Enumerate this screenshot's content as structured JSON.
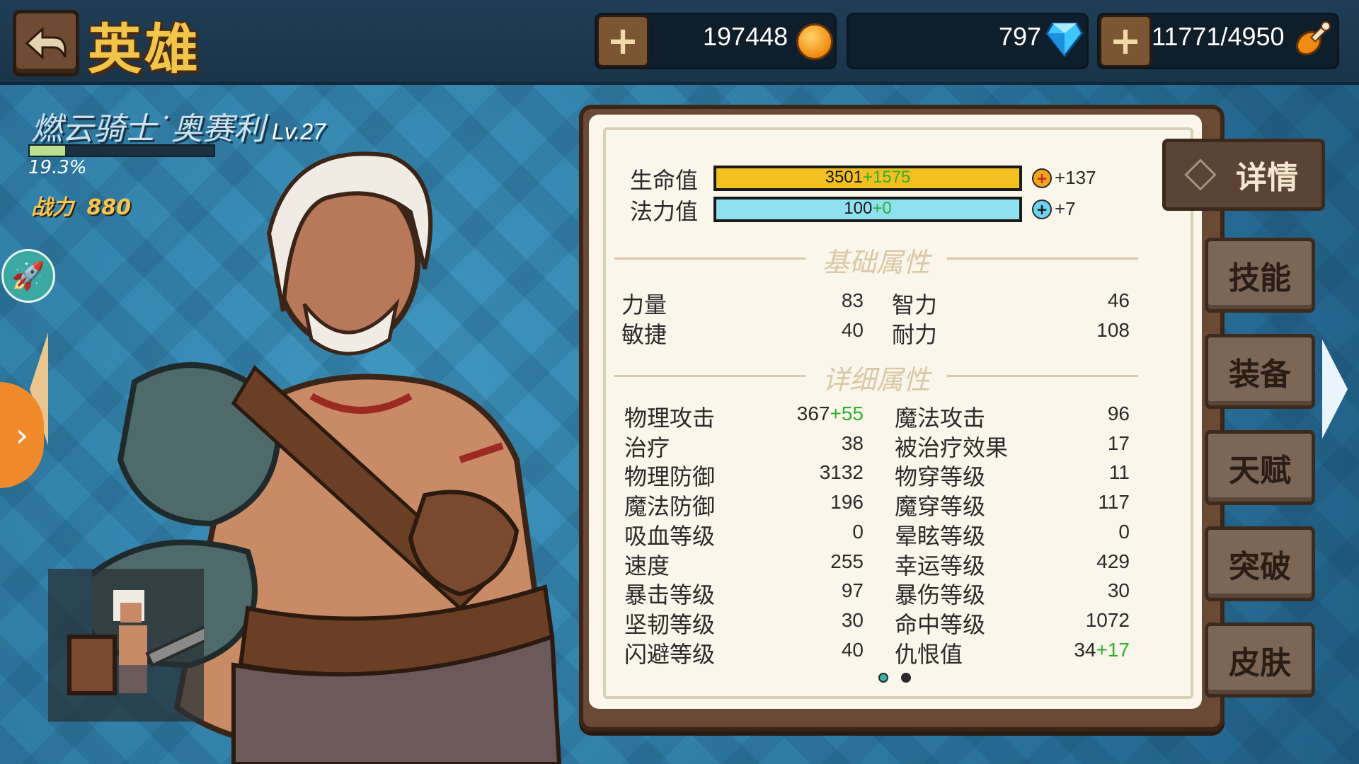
{
  "header": {
    "title": "英雄",
    "gold": "197448",
    "diamonds": "797",
    "stamina": "11771/4950"
  },
  "hero": {
    "name": "燃云骑士˙奥赛利",
    "level": "Lv.27",
    "xp_percent_text": "19.3%",
    "xp_fraction": 0.193,
    "power_label": "战力",
    "power_value": "880"
  },
  "bars": {
    "hp_label": "生命值",
    "hp_base": "3501",
    "hp_bonus": "+1575",
    "hp_extra": "+137",
    "mp_label": "法力值",
    "mp_base": "100",
    "mp_bonus": "+0",
    "mp_extra": "+7",
    "hp_color": "#f2c020",
    "mp_color": "#8fe1f0"
  },
  "basic": {
    "title": "基础属性",
    "rows": [
      {
        "l1": "力量",
        "v1": "83",
        "l2": "智力",
        "v2": "46"
      },
      {
        "l1": "敏捷",
        "v1": "40",
        "l2": "耐力",
        "v2": "108"
      }
    ]
  },
  "detail": {
    "title": "详细属性",
    "rows": [
      {
        "l1": "物理攻击",
        "v1": "367",
        "b1": "+55",
        "l2": "魔法攻击",
        "v2": "96",
        "b2": ""
      },
      {
        "l1": "治疗",
        "v1": "38",
        "b1": "",
        "l2": "被治疗效果",
        "v2": "17",
        "b2": ""
      },
      {
        "l1": "物理防御",
        "v1": "3132",
        "b1": "",
        "l2": "物穿等级",
        "v2": "11",
        "b2": ""
      },
      {
        "l1": "魔法防御",
        "v1": "196",
        "b1": "",
        "l2": "魔穿等级",
        "v2": "117",
        "b2": ""
      },
      {
        "l1": "吸血等级",
        "v1": "0",
        "b1": "",
        "l2": "晕眩等级",
        "v2": "0",
        "b2": ""
      },
      {
        "l1": "速度",
        "v1": "255",
        "b1": "",
        "l2": "幸运等级",
        "v2": "429",
        "b2": ""
      },
      {
        "l1": "暴击等级",
        "v1": "97",
        "b1": "",
        "l2": "暴伤等级",
        "v2": "30",
        "b2": ""
      },
      {
        "l1": "坚韧等级",
        "v1": "30",
        "b1": "",
        "l2": "命中等级",
        "v2": "1072",
        "b2": ""
      },
      {
        "l1": "闪避等级",
        "v1": "40",
        "b1": "",
        "l2": "仇恨值",
        "v2": "34",
        "b2": "+17"
      }
    ]
  },
  "tabs": [
    "详情",
    "技能",
    "装备",
    "天赋",
    "突破",
    "皮肤"
  ],
  "icons": {
    "back": "back-arrow-icon",
    "rocket": "rocket-icon",
    "gold": "coin-icon",
    "diamond": "diamond-icon",
    "stamina": "drumstick-icon"
  }
}
